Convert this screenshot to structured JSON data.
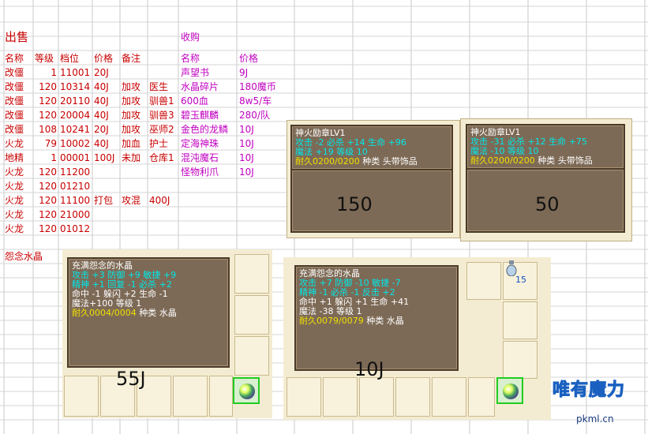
{
  "sheet": {
    "sell_title": "出售",
    "buy_title": "收购",
    "sell_headers": [
      "名称",
      "等级",
      "档位",
      "价格",
      "备注",
      ""
    ],
    "buy_headers": [
      "名称",
      "价格"
    ],
    "sell_rows": [
      [
        "改僵",
        "1",
        "11001",
        "20J",
        "",
        ""
      ],
      [
        "改僵",
        "120",
        "10314",
        "40J",
        "加攻",
        "医生"
      ],
      [
        "改僵",
        "120",
        "20110",
        "40J",
        "加攻",
        "驯兽1"
      ],
      [
        "改僵",
        "120",
        "20004",
        "40J",
        "加攻",
        "驯兽3"
      ],
      [
        "改僵",
        "108",
        "10241",
        "20J",
        "加攻",
        "巫师2"
      ],
      [
        "火龙",
        "79",
        "10002",
        "40J",
        "加血",
        "护士"
      ],
      [
        "地精",
        "1",
        "00001",
        "100J",
        "未加",
        "仓库1"
      ],
      [
        "火龙",
        "120",
        "11200",
        "",
        "",
        ""
      ],
      [
        "火龙",
        "120",
        "01210",
        "",
        "",
        ""
      ],
      [
        "火龙",
        "120",
        "11100",
        "打包",
        "攻混",
        "400J"
      ],
      [
        "火龙",
        "120",
        "21000",
        "",
        "",
        ""
      ],
      [
        "火龙",
        "120",
        "01012",
        "",
        "",
        ""
      ]
    ],
    "buy_rows": [
      [
        "声望书",
        "9J"
      ],
      [
        "水晶碎片",
        "180魔币"
      ],
      [
        "600血",
        "8w5/车"
      ],
      [
        "碧玉麒麟",
        "280/队"
      ],
      [
        "金色的龙鳞",
        "10J"
      ],
      [
        "定海神珠",
        "10J"
      ],
      [
        "混沌魔石",
        "10J"
      ],
      [
        "怪物利爪",
        "10J"
      ]
    ],
    "crystal_label": "怨念水晶"
  },
  "tooltips": {
    "medal1": {
      "title": "神火励章LV1",
      "line1": "攻击  -2 必杀 +14 生命 +96",
      "line2": "魔法 +19 等级 10",
      "line3a": "耐久0200/0200",
      "line3b": " 种类 头带饰品",
      "price": "150"
    },
    "medal2": {
      "title": "神火励章LV1",
      "line1": "攻击 -31 必杀 +12 生命 +75",
      "line2": "魔法 -10 等级 10",
      "line3a": "耐久0200/0200",
      "line3b": " 种类 头带饰品",
      "price": "50"
    },
    "crystal1": {
      "title": "充满怨念的水晶",
      "line1": "攻击  +3 防御  +9 敏捷  +9",
      "line2": "精神  +1 回复  -1 必杀  +2",
      "line3": "命中  -1 躲闪  +2 生命  -1",
      "line4": "魔法+100 等级 1",
      "line5a": "耐久0004/0004",
      "line5b": " 种类 水晶",
      "price": "55J"
    },
    "crystal2": {
      "title": "充满怨念的水晶",
      "line1": "攻击  +7 防御 -10 敏捷  -7",
      "line2": "精神  -1 必杀  -1 反击  +2",
      "line3": "命中  +1 躲闪  +1 生命 +41",
      "line4": "魔法 -38 等级 1",
      "line5a": "耐久0079/0079",
      "line5b": " 种类 水晶",
      "price": "10J"
    },
    "stack_count": "15"
  },
  "watermark": {
    "text": "唯有魔力",
    "url": "pkml.cn"
  },
  "colors": {
    "sell_text": "#c80000",
    "buy_text": "#c000c0",
    "tooltip_bg": "#7d6a56",
    "stat_cyan": "#00e8e8",
    "stat_yellow": "#f0e000"
  }
}
